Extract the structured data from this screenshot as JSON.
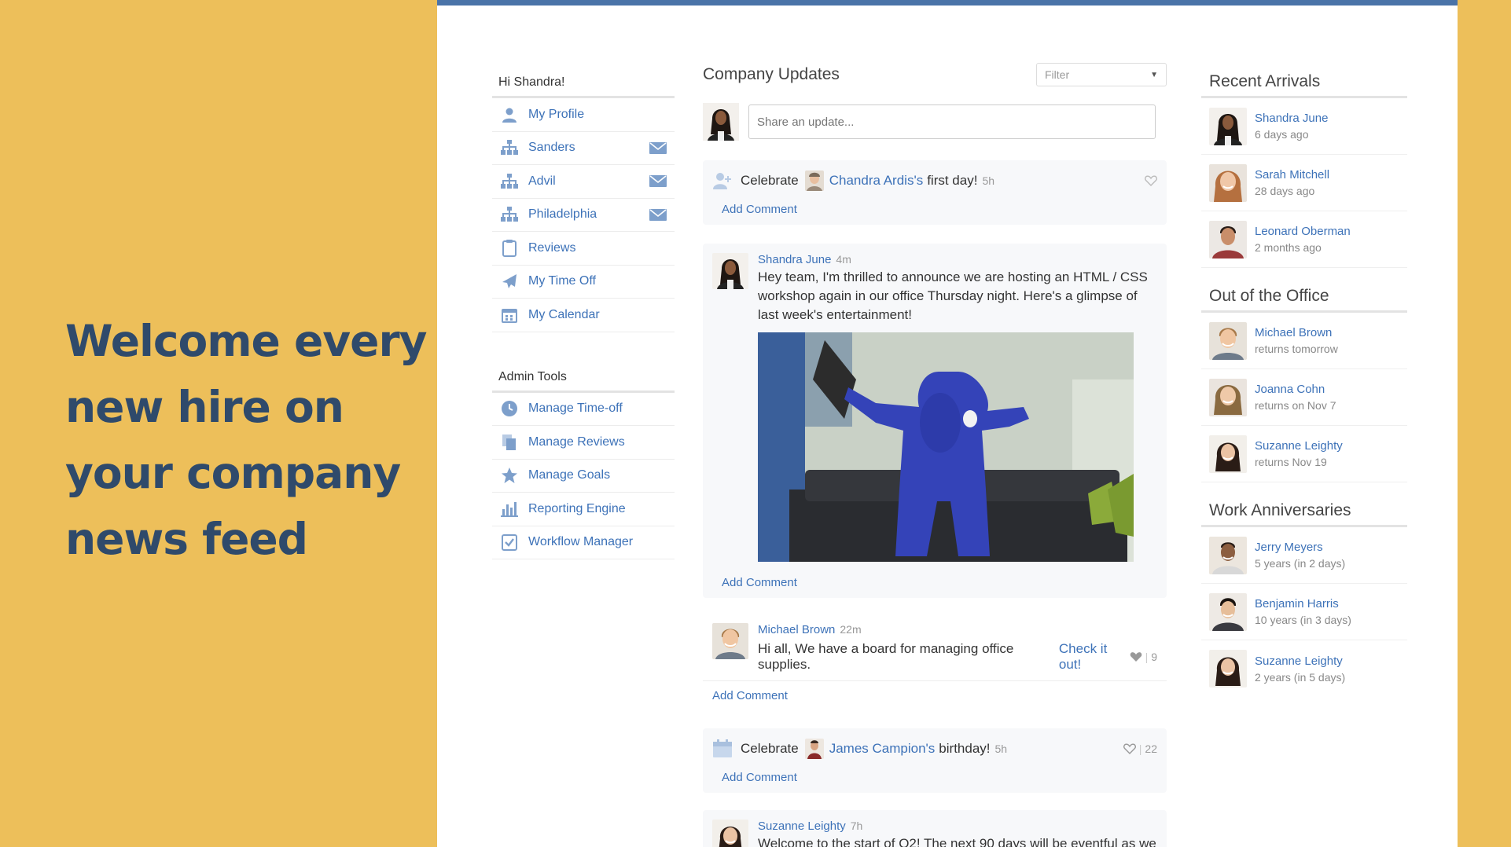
{
  "promo": {
    "lines": [
      "Welcome every",
      "new hire on",
      "your company",
      "news feed"
    ]
  },
  "sidebar": {
    "greeting": "Hi Shandra!",
    "items": [
      {
        "label": "My Profile",
        "icon": "user-icon",
        "mail": false
      },
      {
        "label": "Sanders",
        "icon": "org-chart-icon",
        "mail": true
      },
      {
        "label": "Advil",
        "icon": "org-chart-icon",
        "mail": true
      },
      {
        "label": "Philadelphia",
        "icon": "org-chart-icon",
        "mail": true
      },
      {
        "label": "Reviews",
        "icon": "clipboard-icon",
        "mail": false
      },
      {
        "label": "My Time Off",
        "icon": "airplane-icon",
        "mail": false
      },
      {
        "label": "My Calendar",
        "icon": "calendar-icon",
        "mail": false
      }
    ],
    "admin_heading": "Admin Tools",
    "admin_items": [
      {
        "label": "Manage Time-off",
        "icon": "clock-icon"
      },
      {
        "label": "Manage Reviews",
        "icon": "documents-icon"
      },
      {
        "label": "Manage Goals",
        "icon": "star-icon"
      },
      {
        "label": "Reporting Engine",
        "icon": "bar-chart-icon"
      },
      {
        "label": "Workflow Manager",
        "icon": "checklist-icon"
      }
    ]
  },
  "feed": {
    "title": "Company Updates",
    "filter_placeholder": "Filter",
    "share_placeholder": "Share an update...",
    "add_comment": "Add Comment",
    "celebrate_1": {
      "prefix": "Celebrate",
      "name": "Chandra Ardis's",
      "suffix": "first day!",
      "time": "5h"
    },
    "post_1": {
      "author": "Shandra June",
      "time": "4m",
      "text": "Hey team, I'm thrilled to announce we are hosting an HTML / CSS workshop again in our office Thursday night. Here's a glimpse of last week's entertainment!"
    },
    "post_2": {
      "author": "Michael Brown",
      "time": "22m",
      "text": "Hi all, We have a board for managing office supplies.",
      "link": "Check it out!",
      "likes": "9"
    },
    "celebrate_2": {
      "prefix": "Celebrate",
      "name": "James Campion's",
      "suffix": "birthday!",
      "time": "5h",
      "likes": "22"
    },
    "post_3": {
      "author": "Suzanne Leighty",
      "time": "7h",
      "text": "Welcome to the start of Q2! The next 90 days will be eventful as we"
    }
  },
  "right": {
    "recent_heading": "Recent Arrivals",
    "recent": [
      {
        "name": "Shandra June",
        "sub": "6 days ago"
      },
      {
        "name": "Sarah Mitchell",
        "sub": "28 days ago"
      },
      {
        "name": "Leonard Oberman",
        "sub": "2 months ago"
      }
    ],
    "ooo_heading": "Out of the Office",
    "ooo": [
      {
        "name": "Michael Brown",
        "sub": "returns tomorrow"
      },
      {
        "name": "Joanna Cohn",
        "sub": "returns on Nov 7"
      },
      {
        "name": "Suzanne Leighty",
        "sub": "returns Nov 19"
      }
    ],
    "anniv_heading": "Work Anniversaries",
    "anniv": [
      {
        "name": "Jerry Meyers",
        "sub": "5 years (in 2 days)"
      },
      {
        "name": "Benjamin Harris",
        "sub": "10 years (in 3 days)"
      },
      {
        "name": "Suzanne Leighty",
        "sub": "2 years (in 5 days)"
      }
    ]
  },
  "colors": {
    "background": "#EDBF5A",
    "promo_text": "#2F4A6B",
    "top_bar": "#4A73A8",
    "link": "#3D72B8"
  }
}
